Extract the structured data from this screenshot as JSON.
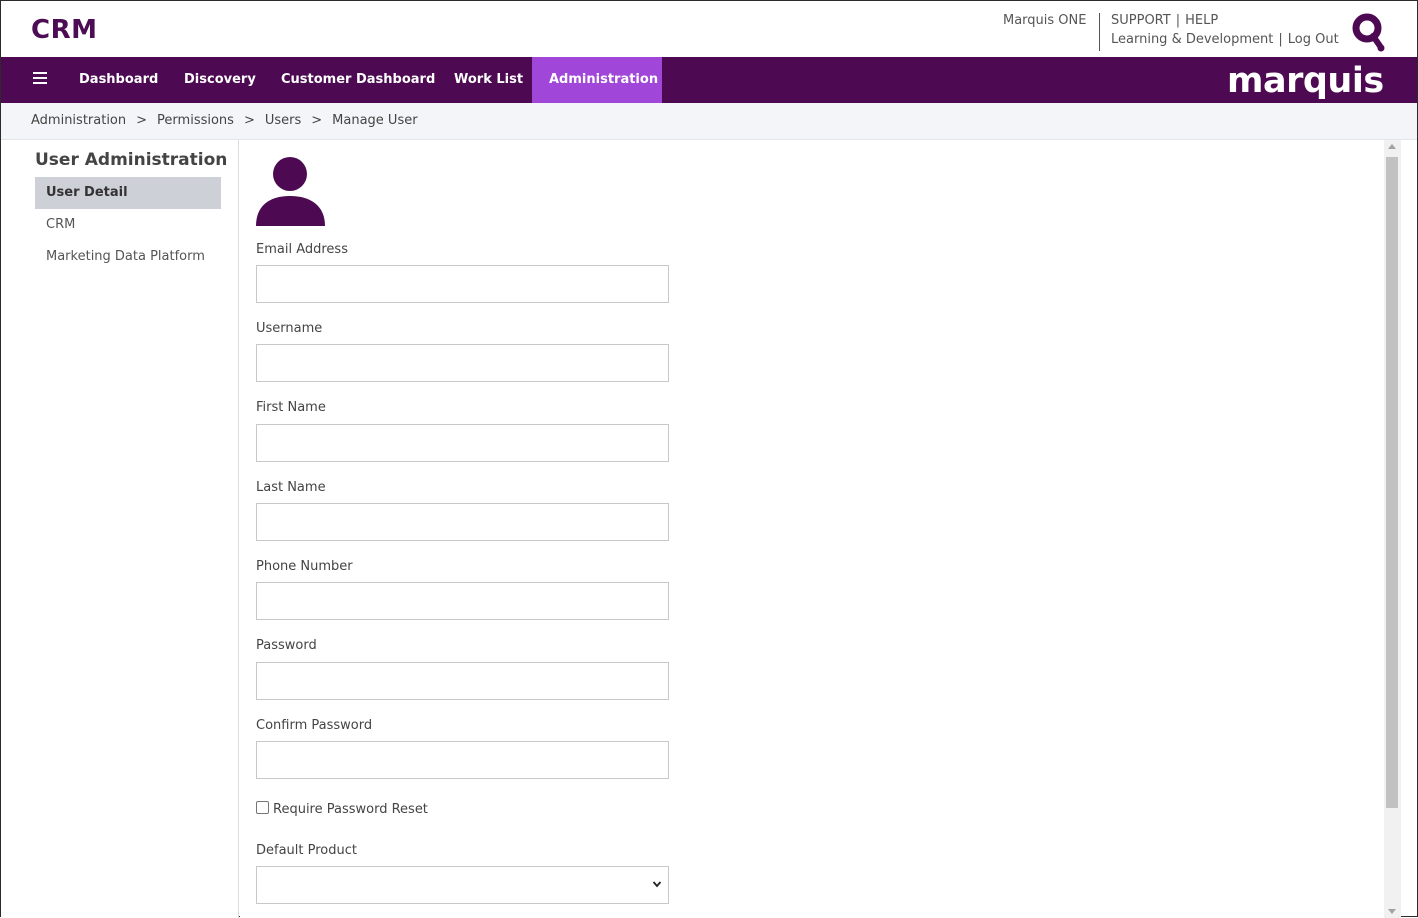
{
  "app": {
    "title": "CRM"
  },
  "header": {
    "product_label": "Marquis ONE",
    "links": {
      "support": "SUPPORT",
      "help": "HELP",
      "learning": "Learning & Development",
      "logout": "Log Out",
      "separator": "|"
    },
    "search_icon": "magnifier-q-logo-icon"
  },
  "nav": {
    "menu_icon": "hamburger-icon",
    "items": [
      {
        "label": "Dashboard"
      },
      {
        "label": "Discovery"
      },
      {
        "label": "Customer Dashboard"
      },
      {
        "label": "Work List"
      },
      {
        "label": "Administration",
        "active": true
      }
    ],
    "brand": "marquis"
  },
  "breadcrumb": {
    "separator": ">",
    "items": [
      "Administration",
      "Permissions",
      "Users",
      "Manage User"
    ]
  },
  "sidebar": {
    "title": "User Administration",
    "items": [
      {
        "label": "User Detail",
        "active": true
      },
      {
        "label": "CRM"
      },
      {
        "label": "Marketing Data Platform"
      }
    ]
  },
  "form": {
    "avatar_icon": "user-avatar-icon",
    "fields": [
      {
        "label": "Email Address",
        "value": ""
      },
      {
        "label": "Username",
        "value": ""
      },
      {
        "label": "First Name",
        "value": ""
      },
      {
        "label": "Last Name",
        "value": ""
      },
      {
        "label": "Phone Number",
        "value": ""
      },
      {
        "label": "Password",
        "value": ""
      },
      {
        "label": "Confirm Password",
        "value": ""
      }
    ],
    "require_reset": {
      "label": "Require Password Reset",
      "checked": false
    },
    "default_product": {
      "label": "Default Product",
      "value": ""
    }
  },
  "colors": {
    "brand_purple": "#4d0a52",
    "active_nav": "#a046d9",
    "sidebar_active": "#cdd0d6",
    "breadcrumb_bg": "#f4f5f8"
  }
}
